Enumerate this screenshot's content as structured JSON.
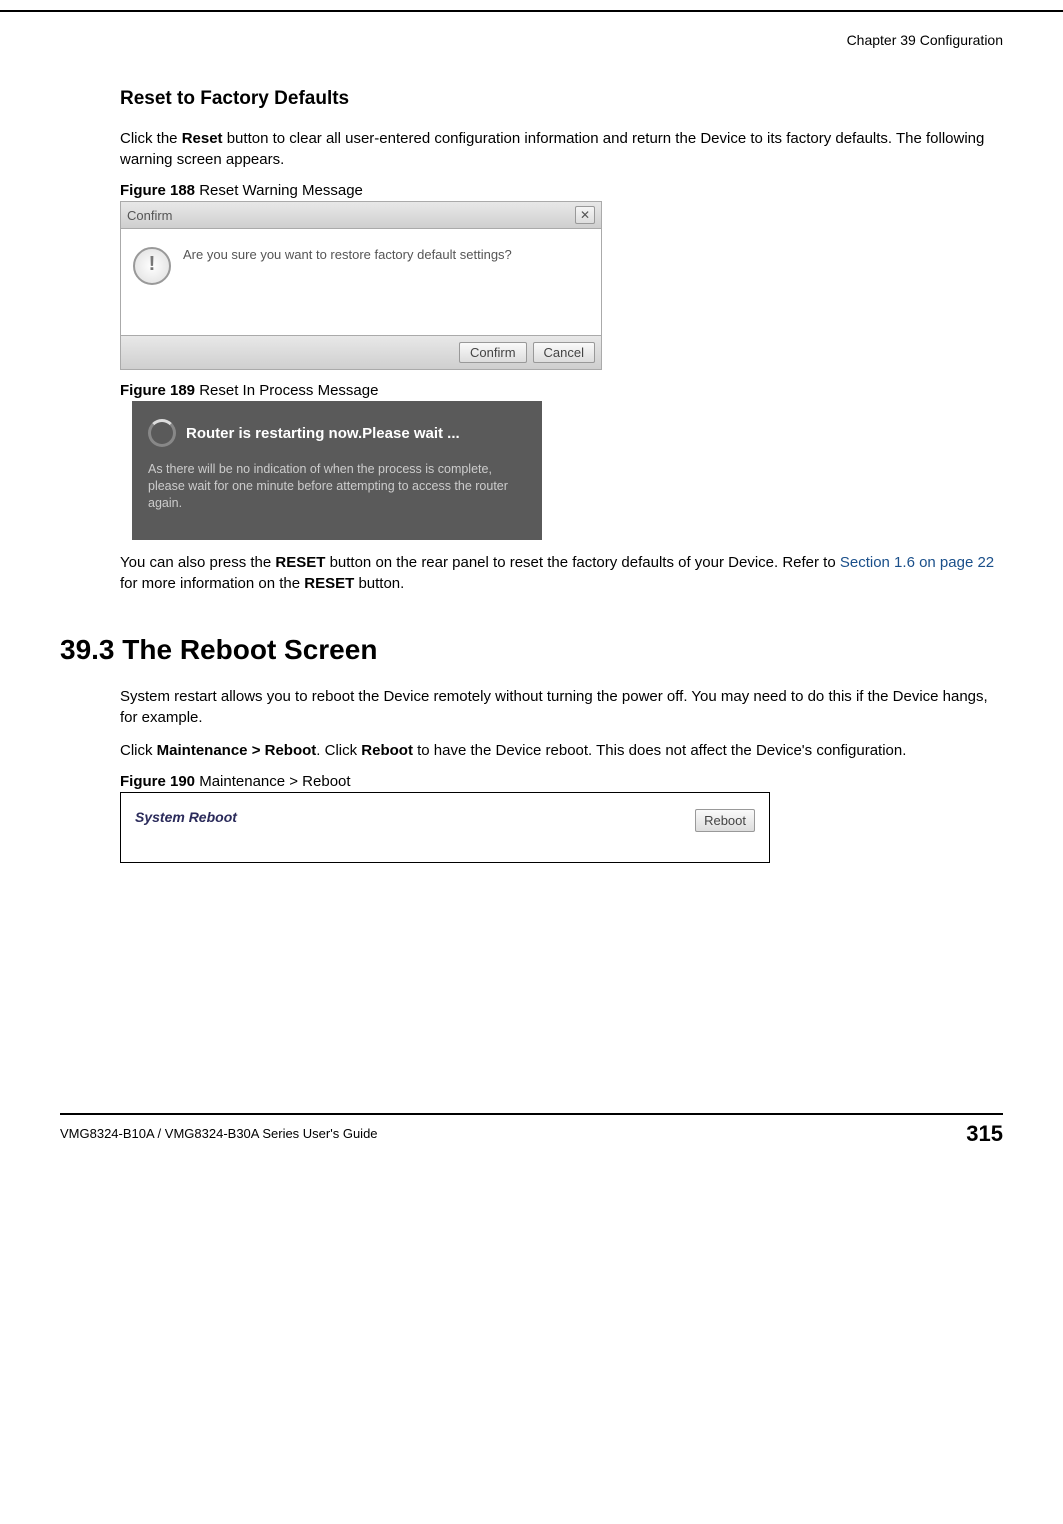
{
  "header": {
    "chapter": "Chapter 39 Configuration"
  },
  "section_reset": {
    "title": "Reset to Factory Defaults",
    "para1_pre": "Click the ",
    "para1_bold": "Reset",
    "para1_post": " button to clear all user-entered configuration information and return the Device to its factory defaults. The following warning screen appears.",
    "fig188_label": "Figure 188",
    "fig188_caption": "   Reset Warning Message",
    "dialog": {
      "title": "Confirm",
      "message": "Are you sure you want to restore factory default settings?",
      "confirm_btn": "Confirm",
      "cancel_btn": "Cancel"
    },
    "fig189_label": "Figure 189",
    "fig189_caption": "   Reset In Process Message",
    "restart": {
      "headline": "Router is restarting now.Please wait ...",
      "detail": "As there will be no indication of when the process is complete, please wait for one minute before attempting to access the router again."
    },
    "para2_a": "You can also press the ",
    "para2_b": "RESET",
    "para2_c": " button on the rear panel to reset the factory defaults of your Device. Refer to ",
    "para2_link": "Section 1.6 on page 22",
    "para2_d": " for more information on the ",
    "para2_e": "RESET",
    "para2_f": " button."
  },
  "section_reboot": {
    "heading": "39.3  The Reboot Screen",
    "para1": "System restart allows you to reboot the Device remotely without turning the power off. You may need to do this if the Device hangs, for example.",
    "para2_a": "Click ",
    "para2_b": "Maintenance > Reboot",
    "para2_c": ". Click ",
    "para2_d": "Reboot",
    "para2_e": " to have the Device reboot. This does not affect the Device's configuration.",
    "fig190_label": "Figure 190",
    "fig190_caption": "   Maintenance > Reboot",
    "panel": {
      "label": "System Reboot",
      "button": "Reboot"
    }
  },
  "footer": {
    "guide": "VMG8324-B10A / VMG8324-B30A Series User's Guide",
    "page": "315"
  }
}
